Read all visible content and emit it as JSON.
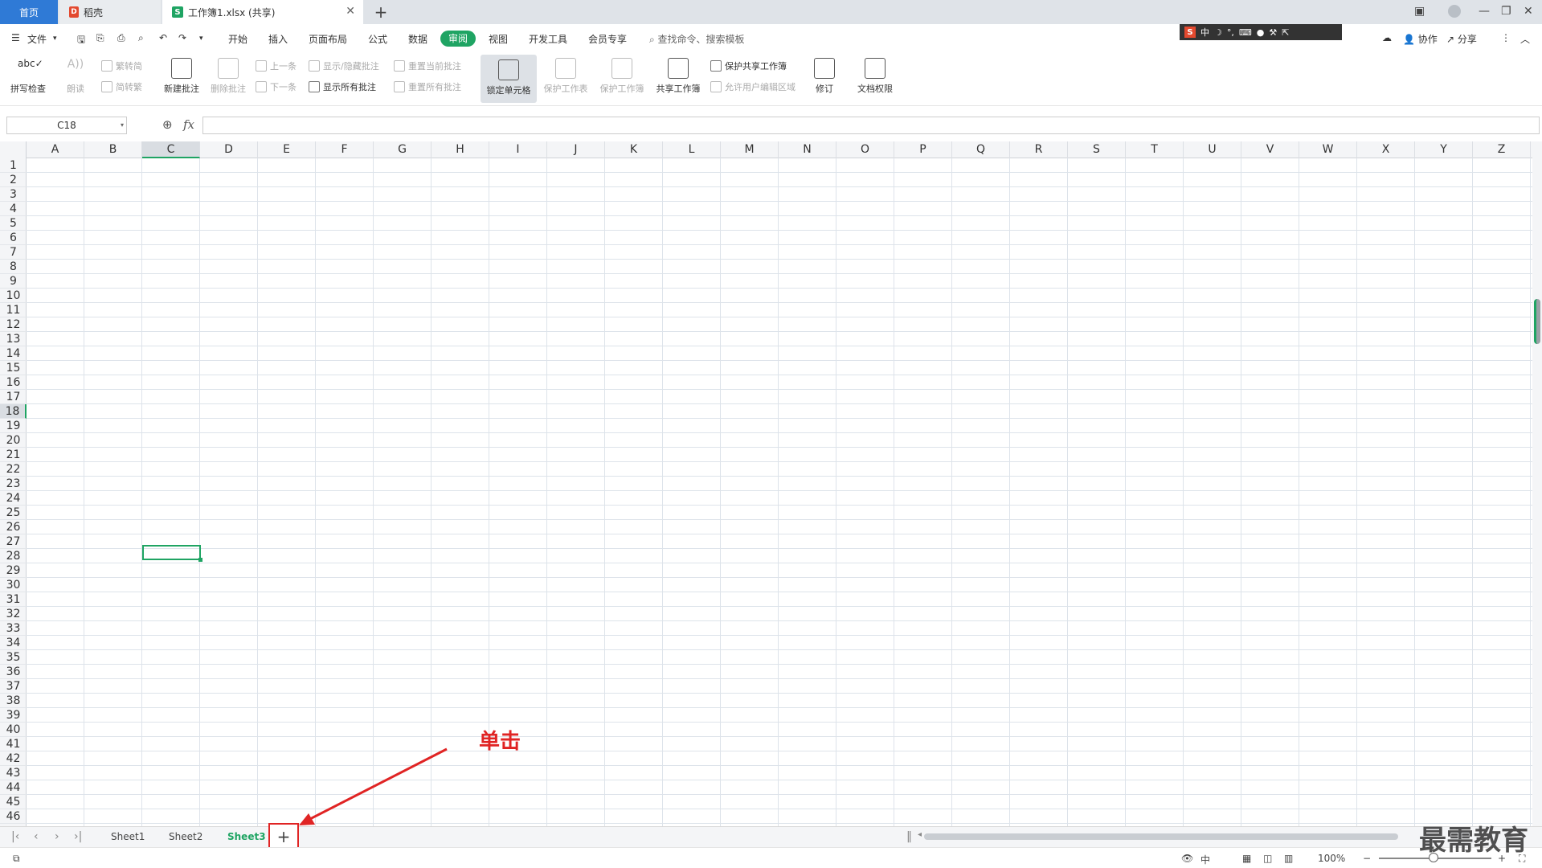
{
  "titlebar": {
    "home_tab": "首页",
    "daoke_tab": "稻壳",
    "workbook_tab": "工作簿1.xlsx (共享)",
    "add_tab": "+"
  },
  "menubar": {
    "file": "文件",
    "items": [
      "开始",
      "插入",
      "页面布局",
      "公式",
      "数据",
      "审阅",
      "视图",
      "开发工具",
      "会员专享"
    ],
    "search": "查找命令、搜索模板",
    "collab": "协作",
    "share": "分享",
    "ime": "中"
  },
  "ribbon": {
    "spell_check": "拼写检查",
    "read_aloud": "朗读",
    "trad_to_simp": "繁转简",
    "simp_to_trad": "简转繁",
    "new_comment": "新建批注",
    "delete_comment": "删除批注",
    "prev_comment": "上一条",
    "next_comment": "下一条",
    "show_hide_comment": "显示/隐藏批注",
    "show_all_comments": "显示所有批注",
    "reset_current_comment": "重置当前批注",
    "reset_all_comments": "重置所有批注",
    "lock_cell": "锁定单元格",
    "protect_sheet": "保护工作表",
    "protect_workbook": "保护工作簿",
    "share_workbook": "共享工作簿",
    "protect_shared_workbook": "保护共享工作簿",
    "allow_edit_ranges": "允许用户编辑区域",
    "track_changes": "修订",
    "doc_permissions": "文档权限"
  },
  "formula_bar": {
    "name_box": "C18",
    "fx": "fx",
    "value": ""
  },
  "grid": {
    "columns": [
      "A",
      "B",
      "C",
      "D",
      "E",
      "F",
      "G",
      "H",
      "I",
      "J",
      "K",
      "L",
      "M",
      "N",
      "O",
      "P",
      "Q",
      "R",
      "S",
      "T",
      "U",
      "V",
      "W",
      "X",
      "Y",
      "Z"
    ],
    "rows": [
      "1",
      "2",
      "3",
      "4",
      "5",
      "6",
      "7",
      "8",
      "9",
      "10",
      "11",
      "12",
      "13",
      "14",
      "15",
      "16",
      "17",
      "18",
      "19",
      "20",
      "21",
      "22",
      "23",
      "24",
      "25",
      "26",
      "27",
      "28",
      "29",
      "30",
      "31",
      "32",
      "33",
      "34",
      "35",
      "36",
      "37",
      "38",
      "39",
      "40",
      "41",
      "42",
      "43",
      "44",
      "45",
      "46"
    ],
    "selected_column": "C",
    "selected_row": "18"
  },
  "sheets": {
    "tabs": [
      "Sheet1",
      "Sheet2",
      "Sheet3"
    ],
    "active": "Sheet3",
    "add": "+"
  },
  "annotation": {
    "label": "单击",
    "color": "#e02424"
  },
  "statusbar": {
    "zoom": "100%",
    "input_mode": "中"
  },
  "watermark": "最需教育",
  "colors": {
    "accent": "#1fa463",
    "home_tab": "#2f7ad6",
    "annotation": "#e02424"
  }
}
